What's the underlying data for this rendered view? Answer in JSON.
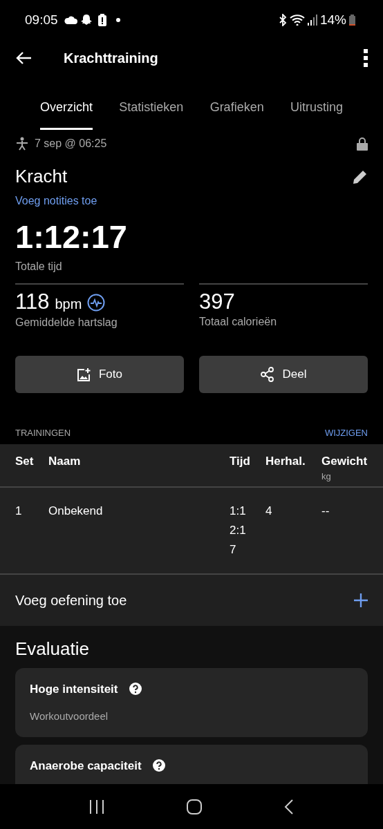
{
  "status_bar": {
    "time": "09:05",
    "battery": "14%"
  },
  "app_bar": {
    "title": "Krachttraining"
  },
  "tabs": [
    {
      "label": "Overzicht",
      "selected": true
    },
    {
      "label": "Statistieken",
      "selected": false
    },
    {
      "label": "Grafieken",
      "selected": false
    },
    {
      "label": "Uitrusting",
      "selected": false
    }
  ],
  "activity": {
    "date": "7 sep @ 06:25",
    "title": "Kracht",
    "notes_link": "Voeg notities toe",
    "total_time": "1:12:17",
    "total_time_label": "Totale tijd"
  },
  "stats": [
    {
      "value": "118",
      "unit": "bpm",
      "label": "Gemiddelde hartslag",
      "kind": "heart"
    },
    {
      "value": "397",
      "label": "Totaal calorieën",
      "kind": "plain"
    }
  ],
  "buttons": [
    {
      "label": "Foto",
      "kind": "photo"
    },
    {
      "label": "Deel",
      "kind": "share"
    }
  ],
  "trainings": {
    "title": "TRAININGEN",
    "action": "WIJZIGEN",
    "columns": [
      {
        "label": "Set"
      },
      {
        "label": "Naam"
      },
      {
        "label": "Tijd"
      },
      {
        "label": "Herhal."
      },
      {
        "label": "Gewicht",
        "unit": "kg"
      }
    ],
    "rows": [
      [
        "1",
        "Onbekend",
        "1:12:17",
        "4",
        "--"
      ]
    ]
  },
  "add_exercise": "Voeg oefening toe",
  "evaluation": {
    "title": "Evaluatie",
    "items": [
      {
        "title": "Hoge intensiteit",
        "subtitle": "Workoutvoordeel"
      },
      {
        "title": "Anaerobe capaciteit"
      }
    ]
  }
}
